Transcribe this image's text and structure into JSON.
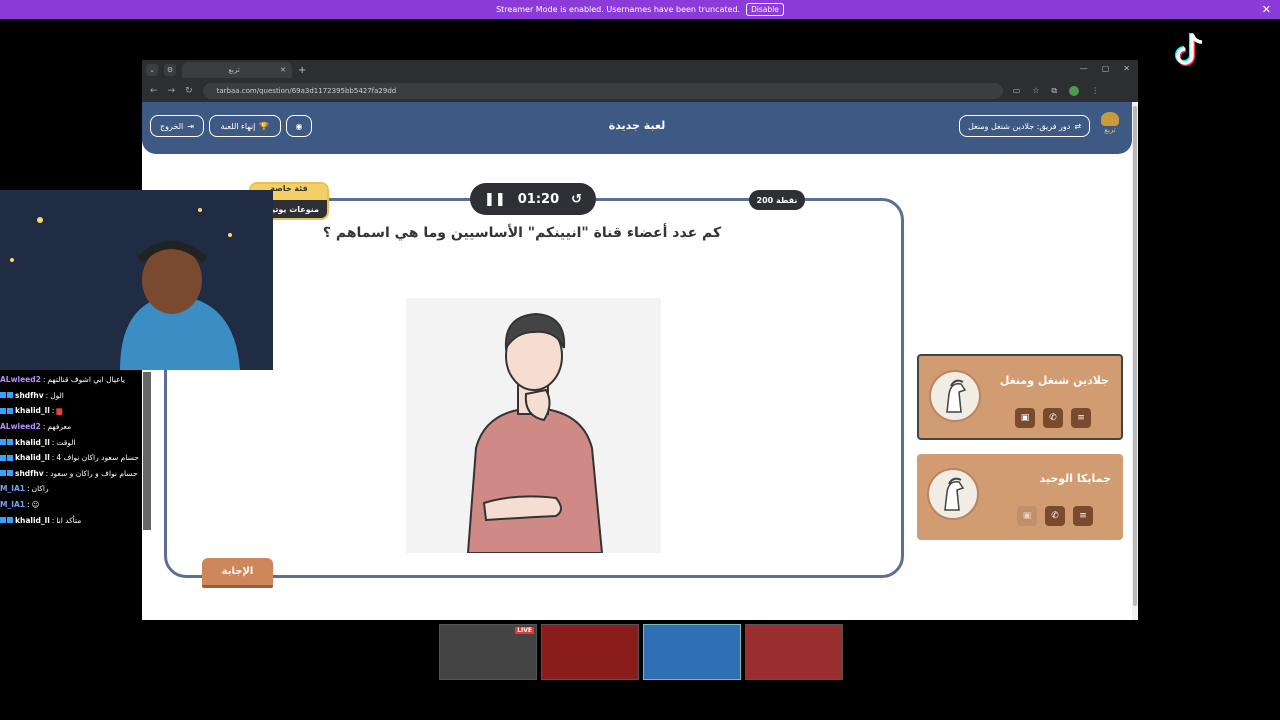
{
  "banner": {
    "text": "Streamer Mode is enabled. Usernames have been truncated.",
    "button": "Disable",
    "close": "✕"
  },
  "browser": {
    "tab_title": "تربع",
    "url": "tarbaa.com/question/69a3d1172395bb5427fa29dd",
    "window_controls": [
      "—",
      "▢",
      "✕"
    ]
  },
  "site": {
    "title": "لعبة جديدة",
    "exit_label": "الخروج",
    "end_game_label": "إنهاء اللعبة",
    "turn_label": "دور فريق: جلادين شنغل ومنغل",
    "logo_text": "تربع"
  },
  "question": {
    "category_top": "فئة خاصة",
    "category_bottom": "منوعات يوتيوب",
    "timer": "01:20",
    "points": "200 نقطة",
    "text": "كم عدد أعضاء قناة \"انيينكم\" الأساسيين وما هي اسماهم ؟",
    "answer_button": "الإجابة"
  },
  "teams": [
    {
      "name": "جلادين شنغل ومنغل",
      "active": true
    },
    {
      "name": "جمايكا الوحيد",
      "active": false
    }
  ],
  "chat": [
    {
      "user": "ALwleed2",
      "color": "#b98cff",
      "msg": "ياعيال ابي اشوف قنالتهم",
      "badges": false
    },
    {
      "user": "shdfhv",
      "color": "#ffffff",
      "msg": "الول",
      "badges": true
    },
    {
      "user": "khalid_ll",
      "color": "#ffffff",
      "msg": "▆",
      "badges": true
    },
    {
      "user": "ALwleed2",
      "color": "#b98cff",
      "msg": "معرفهم",
      "badges": false
    },
    {
      "user": "khalid_ll",
      "color": "#ffffff",
      "msg": "الوقت",
      "badges": true
    },
    {
      "user": "khalid_ll",
      "color": "#ffffff",
      "msg": "4 حسام سعود راكان نواف",
      "badges": true
    },
    {
      "user": "shdfhv",
      "color": "#ffffff",
      "msg": "حسام نواف و راكان و سعود",
      "badges": true
    },
    {
      "user": "M_IA1",
      "color": "#6aa8ff",
      "msg": "راكان",
      "badges": false
    },
    {
      "user": "M_IA1",
      "color": "#6aa8ff",
      "msg": "☺",
      "badges": false
    },
    {
      "user": "khalid_ll",
      "color": "#ffffff",
      "msg": "متأكد انا",
      "badges": true
    }
  ],
  "taskbar": {
    "live_label": "LIVE"
  }
}
